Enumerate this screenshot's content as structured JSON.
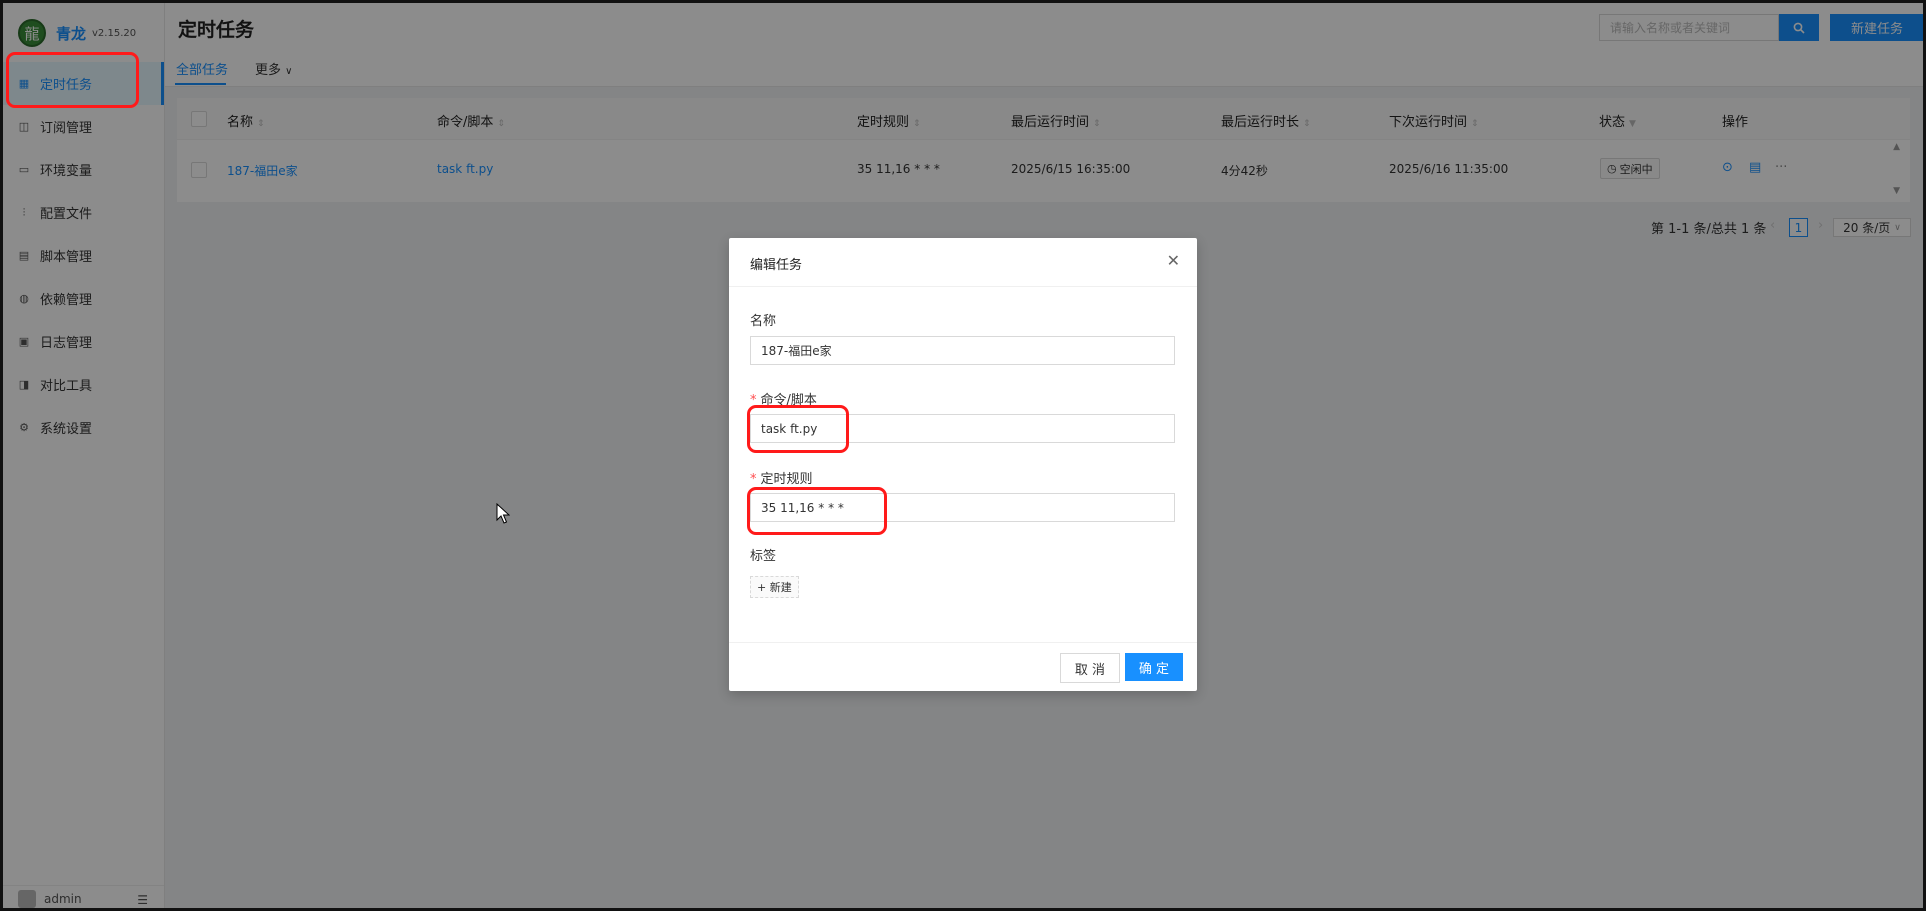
{
  "app": {
    "name": "青龙",
    "version": "v2.15.20"
  },
  "sidebar": {
    "items": [
      {
        "label": "定时任务",
        "icon": "calendar-icon",
        "active": true
      },
      {
        "label": "订阅管理",
        "icon": "subscribe-icon"
      },
      {
        "label": "环境变量",
        "icon": "monitor-icon"
      },
      {
        "label": "配置文件",
        "icon": "sliders-icon"
      },
      {
        "label": "脚本管理",
        "icon": "file-icon"
      },
      {
        "label": "依赖管理",
        "icon": "package-icon"
      },
      {
        "label": "日志管理",
        "icon": "log-icon"
      },
      {
        "label": "对比工具",
        "icon": "compare-icon"
      },
      {
        "label": "系统设置",
        "icon": "gear-icon"
      }
    ],
    "user": "admin"
  },
  "header": {
    "title": "定时任务",
    "search_placeholder": "请输入名称或者关键词",
    "new_task": "新建任务"
  },
  "tabs": {
    "all": "全部任务",
    "more": "更多"
  },
  "table": {
    "columns": [
      "名称",
      "命令/脚本",
      "定时规则",
      "最后运行时间",
      "最后运行时长",
      "下次运行时间",
      "状态",
      "操作"
    ],
    "rows": [
      {
        "name": "187-福田e家",
        "command": "task ft.py",
        "schedule": "35 11,16 * * *",
        "last_run": "2025/6/15 16:35:00",
        "duration": "4分42秒",
        "next_run": "2025/6/16 11:35:00",
        "status": "空闲中"
      }
    ]
  },
  "pagination": {
    "summary": "第 1-1 条/总共 1 条",
    "current": "1",
    "page_size": "20 条/页"
  },
  "modal": {
    "title": "编辑任务",
    "name_label": "名称",
    "name_value": "187-福田e家",
    "command_label": "命令/脚本",
    "command_value": "task ft.py",
    "schedule_label": "定时规则",
    "schedule_value": "35 11,16 * * *",
    "tags_label": "标签",
    "new_tag": "+ 新建",
    "cancel": "取 消",
    "ok": "确 定"
  },
  "colors": {
    "primary": "#1890ff",
    "annotation": "#ff1a1a"
  }
}
